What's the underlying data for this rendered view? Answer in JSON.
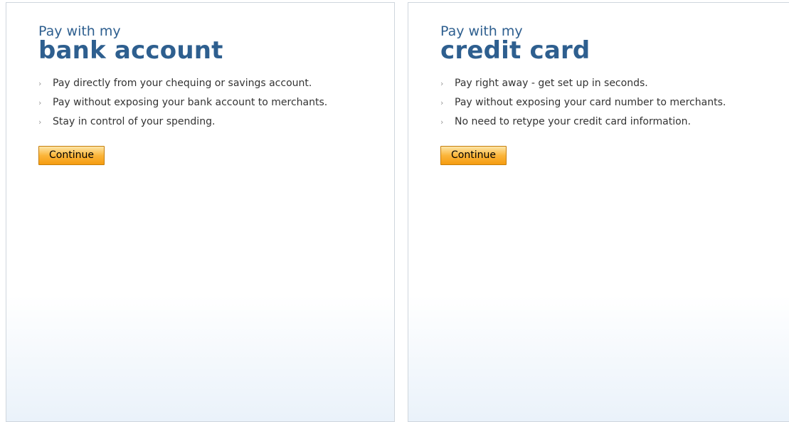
{
  "bank": {
    "kicker": "Pay with my",
    "headline": "bank account",
    "bullets": [
      "Pay directly from your chequing or savings account.",
      "Pay without exposing your bank account to merchants.",
      "Stay in control of your spending."
    ],
    "button_label": "Continue"
  },
  "card": {
    "kicker": "Pay with my",
    "headline": "credit card",
    "bullets": [
      "Pay right away - get set up in seconds.",
      "Pay without exposing your card number to merchants.",
      "No need to retype your credit card information."
    ],
    "button_label": "Continue"
  },
  "colors": {
    "heading": "#2e5f8f",
    "button_top": "#fde6a8",
    "button_bottom": "#f59c10",
    "panel_fade": "#eaf2fa"
  },
  "icons": {
    "bullet": "chevron-right-icon"
  }
}
